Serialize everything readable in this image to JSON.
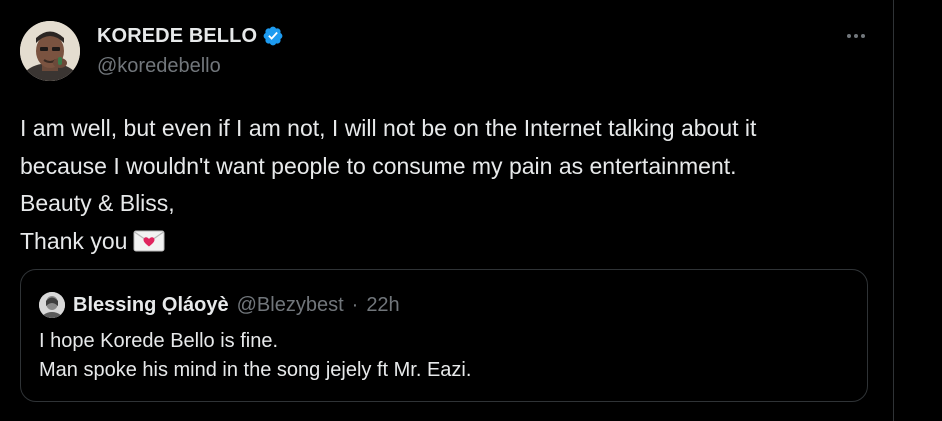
{
  "author": {
    "name": "KOREDE BELLO",
    "handle": "@koredebello",
    "verified": true,
    "avatar_icon": "profile-photo"
  },
  "more_icon": "more-horizontal-icon",
  "tweet": {
    "lines": [
      "I am well, but even if I am not, I will not be on the Internet talking about it",
      "because I wouldn't want people to consume my pain as entertainment.",
      "Beauty & Bliss,",
      "Thank you"
    ],
    "emoji": "love-letter-emoji"
  },
  "quote": {
    "name": "Blessing Ọláoyè",
    "handle": "@Blezybest",
    "separator": "·",
    "time": "22h",
    "lines": [
      "I hope Korede Bello is fine.",
      "Man spoke his mind in the song jejely ft Mr. Eazi."
    ]
  },
  "colors": {
    "background": "#000000",
    "text_primary": "#e7e9ea",
    "text_secondary": "#71767b",
    "verified_blue": "#1d9bf0",
    "border": "#2f3336"
  }
}
